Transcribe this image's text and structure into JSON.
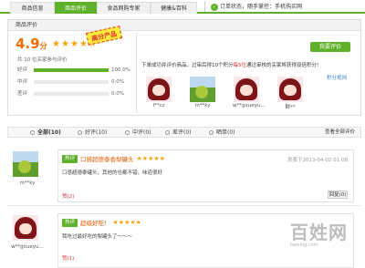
{
  "nav": {
    "tabs": [
      "商品信息",
      "商品评价",
      "食品网购专家",
      "健康&百科"
    ],
    "active_tab": 1,
    "order_text": "订单状态，随手掌控：手机购买网",
    "accent": "#5fb12a"
  },
  "summary": {
    "header": "商品评价",
    "score": "4.9",
    "unit": "分",
    "badge": "高分产品",
    "stars": 4.5,
    "count_text": "共 10 位买家参与评价",
    "ratings": [
      {
        "label": "好评",
        "percent": 100,
        "pct_text": "100.0%"
      },
      {
        "label": "中评",
        "percent": 0,
        "pct_text": "0.0%"
      },
      {
        "label": "差评",
        "percent": 0,
        "pct_text": "0.0%"
      }
    ],
    "write_button": "我要评价",
    "promo_prefix": "下单成功并评价商品，过审后得10个积分",
    "promo_highlight": "每5位",
    "promo_suffix": "通过审核的买家将获得双倍积分!",
    "points_link": "积分规则",
    "avatars": [
      {
        "name": "l**cz",
        "pic": "girl"
      },
      {
        "name": "m**ky",
        "pic": "field"
      },
      {
        "name": "w**gxueyu...",
        "pic": "girl"
      },
      {
        "name": "群**",
        "pic": "girl"
      }
    ]
  },
  "filters": {
    "items": [
      "全部(10)",
      "好评(10)",
      "中评(0)",
      "差评(0)",
      "晒单(0)"
    ],
    "all_link": "查看全部评价"
  },
  "reviews": [
    {
      "user": "m**ky",
      "pic": "field",
      "tag": "热评",
      "title": "口感超德泰香梨罐头",
      "stars": "★★★★★",
      "time": "发表于2013-04-02 01:08",
      "text": "口感超德泰罐头，其他的也都不错，味道很好",
      "likes": "赞(2)",
      "reply": "回复(0)"
    },
    {
      "user": "w**gxueyu...",
      "pic": "girl",
      "tag": "热评",
      "title": "超级好吃！",
      "stars": "★★★★★",
      "text": "我吃过最好吃的梨罐头了～～～",
      "likes": "赞(1)"
    }
  ],
  "watermark": {
    "big": "百姓网",
    "small": "baixing.com"
  }
}
